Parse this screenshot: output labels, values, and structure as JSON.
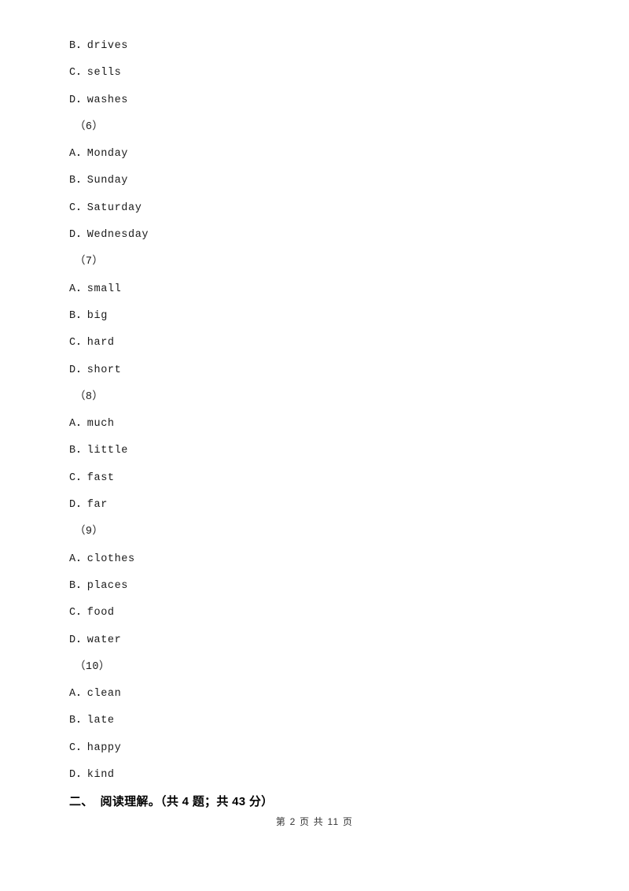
{
  "document": {
    "lines": [
      {
        "type": "option",
        "text": "B．drives"
      },
      {
        "type": "option",
        "text": "C．sells"
      },
      {
        "type": "option",
        "text": "D．washes"
      },
      {
        "type": "qnum",
        "text": "（6）"
      },
      {
        "type": "option",
        "text": "A．Monday"
      },
      {
        "type": "option",
        "text": "B．Sunday"
      },
      {
        "type": "option",
        "text": "C．Saturday"
      },
      {
        "type": "option",
        "text": "D．Wednesday"
      },
      {
        "type": "qnum",
        "text": "（7）"
      },
      {
        "type": "option",
        "text": "A．small"
      },
      {
        "type": "option",
        "text": "B．big"
      },
      {
        "type": "option",
        "text": "C．hard"
      },
      {
        "type": "option",
        "text": "D．short"
      },
      {
        "type": "qnum",
        "text": "（8）"
      },
      {
        "type": "option",
        "text": "A．much"
      },
      {
        "type": "option",
        "text": "B．little"
      },
      {
        "type": "option",
        "text": "C．fast"
      },
      {
        "type": "option",
        "text": "D．far"
      },
      {
        "type": "qnum",
        "text": "（9）"
      },
      {
        "type": "option",
        "text": "A．clothes"
      },
      {
        "type": "option",
        "text": "B．places"
      },
      {
        "type": "option",
        "text": "C．food"
      },
      {
        "type": "option",
        "text": "D．water"
      },
      {
        "type": "qnum",
        "text": "（10）"
      },
      {
        "type": "option",
        "text": "A．clean"
      },
      {
        "type": "option",
        "text": "B．late"
      },
      {
        "type": "option",
        "text": "C．happy"
      },
      {
        "type": "option",
        "text": "D．kind"
      }
    ],
    "section_heading": "二、  阅读理解。（共 4 题；共 43 分）",
    "footer": "第 2 页 共 11 页"
  }
}
